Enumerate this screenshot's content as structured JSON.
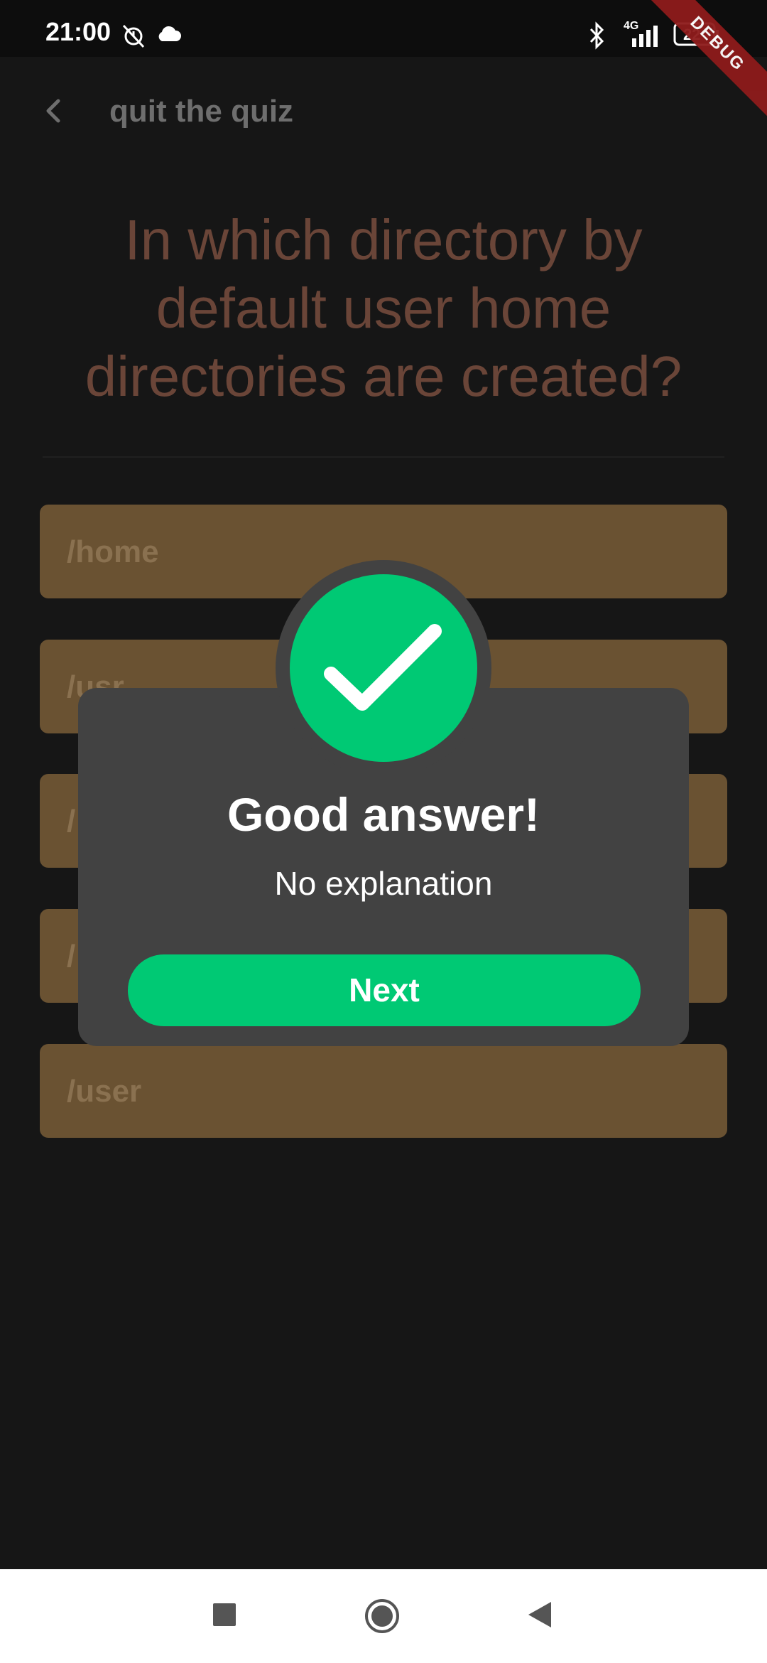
{
  "status_bar": {
    "time": "21:00",
    "network": "4G",
    "battery": "22",
    "debug_banner": "DEBUG",
    "icons": [
      "mute-alarm-icon",
      "cloud-icon",
      "bluetooth-icon",
      "signal-icon",
      "battery-icon"
    ]
  },
  "app_bar": {
    "title": "quit the quiz",
    "back_icon": "chevron-left-icon"
  },
  "question": {
    "text": "In which directory by default user home directories are created?"
  },
  "options": [
    {
      "label": "/home"
    },
    {
      "label": "/usr"
    },
    {
      "label": "/"
    },
    {
      "label": "/"
    },
    {
      "label": "/user"
    }
  ],
  "dialog": {
    "icon": "checkmark-icon",
    "title": "Good answer!",
    "subtitle": "No explanation",
    "next_label": "Next"
  },
  "nav_bar": {
    "icons": [
      "recents-square-icon",
      "home-circle-icon",
      "back-triangle-icon"
    ]
  },
  "colors": {
    "background": "#161616",
    "option_fill": "#6a5232",
    "question_text": "#6a4538",
    "success_green": "#00c974",
    "dialog_bg": "#424242",
    "debug_ribbon": "#8e1b1b"
  }
}
